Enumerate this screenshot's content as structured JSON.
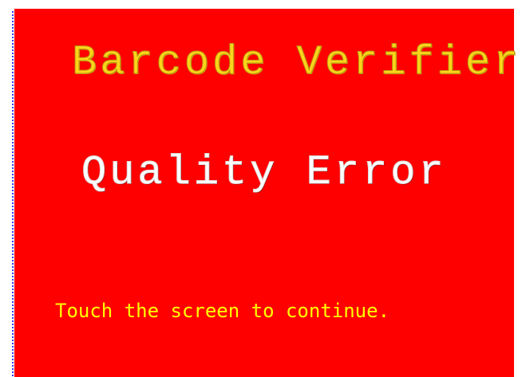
{
  "screen": {
    "background_color": "#ff0000",
    "title": "Barcode Verifier",
    "title_color": "#ffd51a",
    "message": "Quality Error",
    "message_color": "#ffffff",
    "prompt": "Touch the screen to continue.",
    "prompt_color": "#ffff00"
  }
}
